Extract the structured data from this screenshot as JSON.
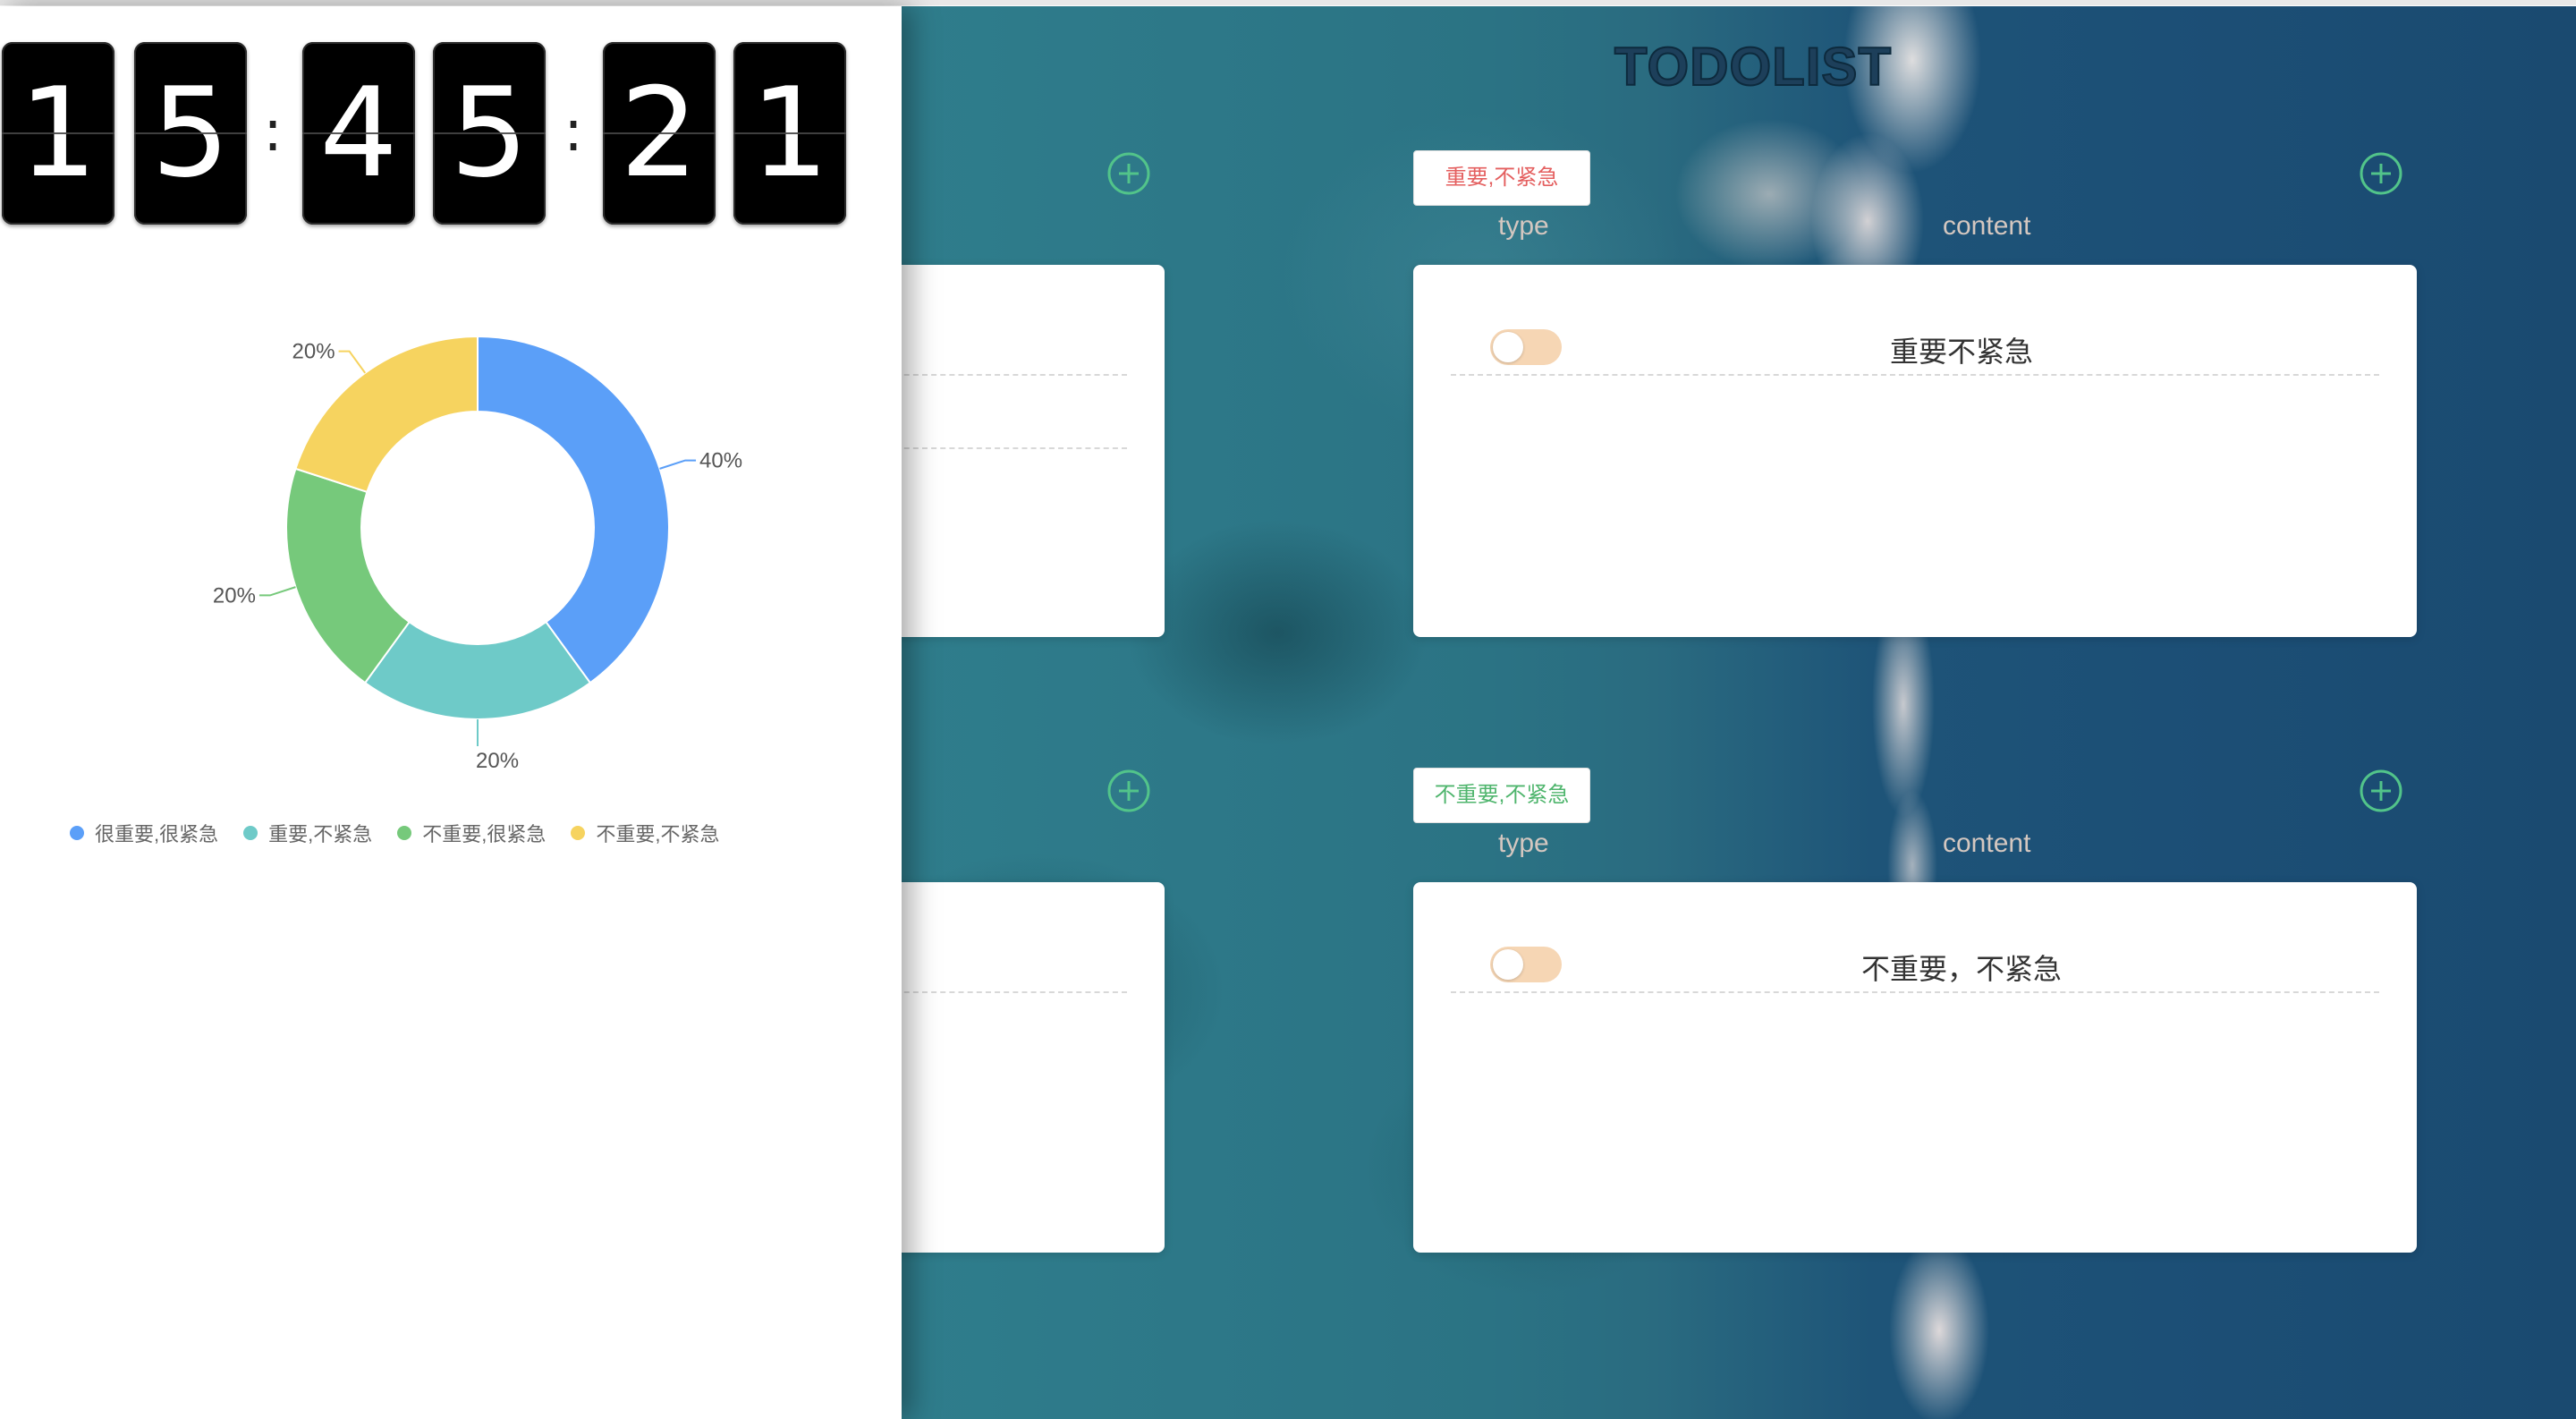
{
  "app": {
    "title": "TODOLIST"
  },
  "clock": {
    "h1": "1",
    "h2": "5",
    "m1": "4",
    "m2": "5",
    "s1": "2",
    "s2": "1",
    "sep": ":"
  },
  "chart_data": {
    "type": "pie",
    "donut": true,
    "categories": [
      "很重要,很紧急",
      "重要,不紧急",
      "不重要,很紧急",
      "不重要,不紧急"
    ],
    "values": [
      40,
      20,
      20,
      20
    ],
    "labels": [
      "40%",
      "20%",
      "20%",
      "20%"
    ],
    "colors": [
      "#5b9ff8",
      "#6ecac8",
      "#76c97b",
      "#f6d35f"
    ],
    "legend_position": "bottom"
  },
  "quadrants": {
    "top": {
      "tag": "重要,不紧急",
      "tag_color": "#e45f5f",
      "type_label": "type",
      "content_label": "content",
      "todos": [
        {
          "text": "重要不紧急",
          "done": false
        }
      ]
    },
    "bottom": {
      "tag": "不重要,不紧急",
      "tag_color": "#4fb56d",
      "type_label": "type",
      "content_label": "content",
      "todos": [
        {
          "text": "不重要，不紧急",
          "done": false
        }
      ]
    }
  },
  "icons": {
    "add": "plus-circle-icon",
    "toggle": "toggle-switch-icon"
  },
  "colors": {
    "accent_green": "#52c48a",
    "toggle_track": "#f6d6b4"
  }
}
